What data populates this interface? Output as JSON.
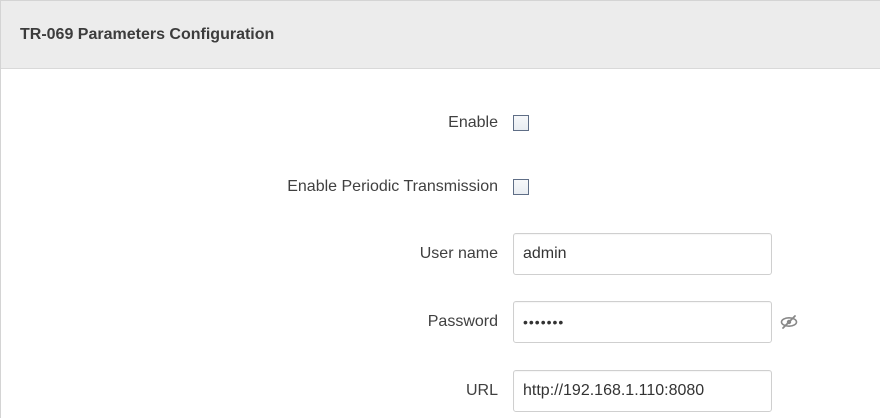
{
  "panel": {
    "title": "TR-069 Parameters Configuration"
  },
  "fields": {
    "enable": {
      "label": "Enable",
      "checked": false
    },
    "periodic": {
      "label": "Enable Periodic Transmission",
      "checked": false
    },
    "username": {
      "label": "User name",
      "value": "admin"
    },
    "password": {
      "label": "Password",
      "masked_value": "•••••••"
    },
    "url": {
      "label": "URL",
      "value": "http://192.168.1.110:8080"
    }
  },
  "icons": {
    "password_toggle": "eye-slash-icon"
  }
}
